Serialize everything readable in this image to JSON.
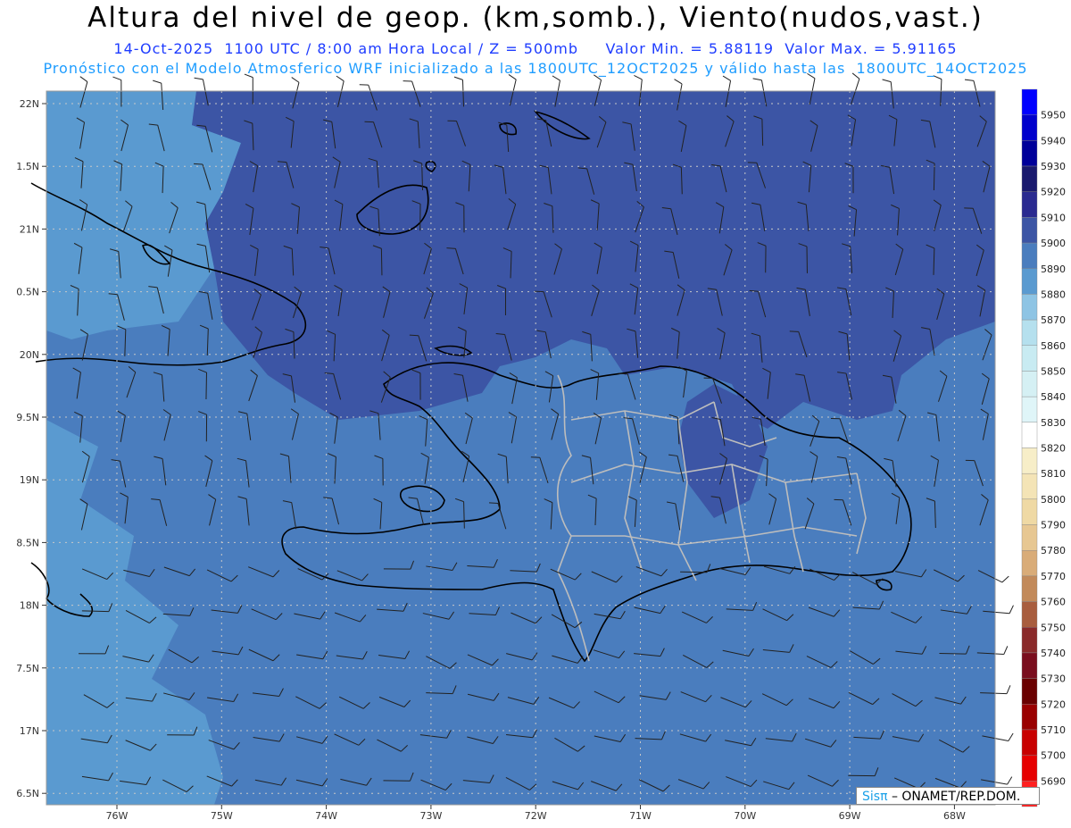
{
  "title": "Altura del nivel de geop. (km,somb.), Viento(nudos,vast.)",
  "subtitle1": "14-Oct-2025  1100 UTC / 8:00 am Hora Local / Z = 500mb     Valor Min. = 5.88119  Valor Max. = 5.91165",
  "subtitle2": "Pronóstico con el Modelo Atmosferico WRF inicializado a las 1800UTC_12OCT2025 y válido hasta las  1800UTC_14OCT2025",
  "footer": {
    "sis": "Sisπ",
    "org": "– ONAMET/REP.DOM."
  },
  "lat_labels": [
    "22N",
    "1.5N",
    "21N",
    "0.5N",
    "20N",
    "9.5N",
    "19N",
    "8.5N",
    "18N",
    "7.5N",
    "17N",
    "6.5N"
  ],
  "lon_labels": [
    "76W",
    "75W",
    "74W",
    "73W",
    "72W",
    "71W",
    "70W",
    "69W",
    "68W"
  ],
  "colorbar": {
    "levels": [
      "5950",
      "5940",
      "5930",
      "5920",
      "5910",
      "5900",
      "5890",
      "5880",
      "5870",
      "5860",
      "5850",
      "5840",
      "5830",
      "5820",
      "5810",
      "5800",
      "5790",
      "5780",
      "5770",
      "5760",
      "5750",
      "5740",
      "5730",
      "5720",
      "5710",
      "5700",
      "5690"
    ],
    "colors": [
      "#0000ff",
      "#0000cc",
      "#00009a",
      "#1a1a6e",
      "#2a2a90",
      "#3c55a5",
      "#4a7dbe",
      "#5a9ad0",
      "#8ec4e4",
      "#b5e0ee",
      "#c8ebf2",
      "#d5f0f4",
      "#dff5f8",
      "#ffffff",
      "#f7eec8",
      "#f4e4b6",
      "#efd9a4",
      "#e7c792",
      "#d9ac78",
      "#c28a5a",
      "#a85d3e",
      "#8a2a2a",
      "#7a0e1e",
      "#6a0000",
      "#9a0000",
      "#c80000",
      "#e60000",
      "#ff2020"
    ]
  },
  "colors": {
    "shade_high": "#3c55a5",
    "shade_mid": "#4a7dbe",
    "shade_low": "#5a9ad0",
    "border": "#bdbdbd"
  }
}
